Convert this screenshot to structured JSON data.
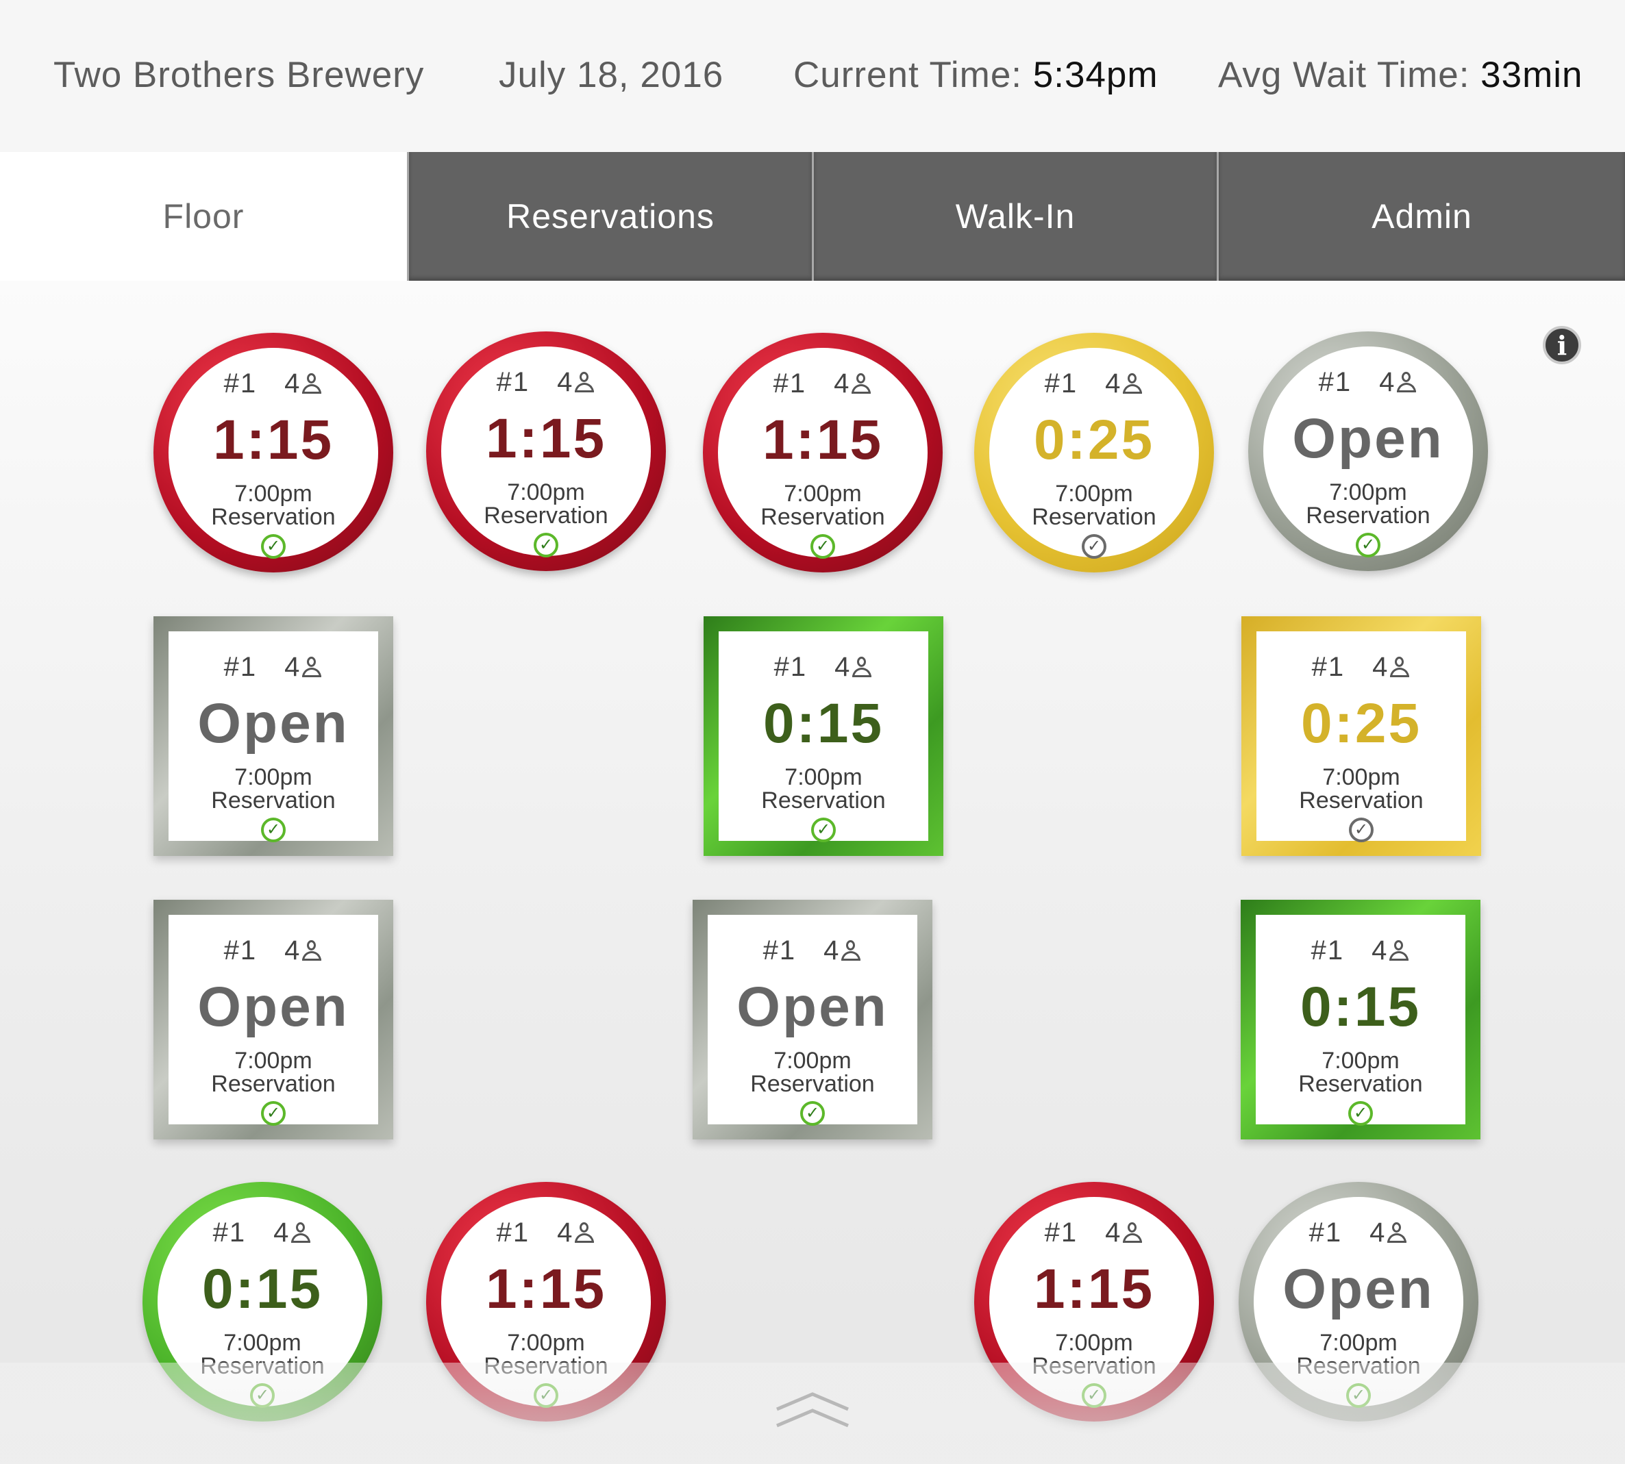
{
  "header": {
    "restaurant": "Two Brothers Brewery",
    "date": "July 18, 2016",
    "current_time_label": "Current Time:",
    "current_time_value": "5:34pm",
    "avg_wait_label": "Avg Wait Time:",
    "avg_wait_value": "33min"
  },
  "tabs": [
    {
      "label": "Floor",
      "active": true
    },
    {
      "label": "Reservations"
    },
    {
      "label": "Walk-In"
    },
    {
      "label": "Admin"
    }
  ],
  "tables": [
    {
      "number": "#1",
      "seats": "4",
      "big": "1:15",
      "time": "7:00pm",
      "label": "Reservation",
      "status": "red",
      "confirmed": true
    },
    {
      "number": "#1",
      "seats": "4",
      "big": "1:15",
      "time": "7:00pm",
      "label": "Reservation",
      "status": "red",
      "confirmed": true
    },
    {
      "number": "#1",
      "seats": "4",
      "big": "1:15",
      "time": "7:00pm",
      "label": "Reservation",
      "status": "red",
      "confirmed": true
    },
    {
      "number": "#1",
      "seats": "4",
      "big": "0:25",
      "time": "7:00pm",
      "label": "Reservation",
      "status": "yellow",
      "confirmed": false
    },
    {
      "number": "#1",
      "seats": "4",
      "big": "Open",
      "time": "7:00pm",
      "label": "Reservation",
      "status": "gray",
      "confirmed": true
    },
    {
      "number": "#1",
      "seats": "4",
      "big": "Open",
      "time": "7:00pm",
      "label": "Reservation",
      "status": "gray",
      "confirmed": true
    },
    {
      "number": "#1",
      "seats": "4",
      "big": "0:15",
      "time": "7:00pm",
      "label": "Reservation",
      "status": "green",
      "confirmed": true
    },
    {
      "number": "#1",
      "seats": "4",
      "big": "0:25",
      "time": "7:00pm",
      "label": "Reservation",
      "status": "yellow",
      "confirmed": false
    },
    {
      "number": "#1",
      "seats": "4",
      "big": "Open",
      "time": "7:00pm",
      "label": "Reservation",
      "status": "gray",
      "confirmed": true
    },
    {
      "number": "#1",
      "seats": "4",
      "big": "Open",
      "time": "7:00pm",
      "label": "Reservation",
      "status": "gray",
      "confirmed": true
    },
    {
      "number": "#1",
      "seats": "4",
      "big": "0:15",
      "time": "7:00pm",
      "label": "Reservation",
      "status": "green",
      "confirmed": true
    },
    {
      "number": "#1",
      "seats": "4",
      "big": "0:15",
      "time": "7:00pm",
      "label": "Reservation",
      "status": "green",
      "confirmed": true
    },
    {
      "number": "#1",
      "seats": "4",
      "big": "1:15",
      "time": "7:00pm",
      "label": "Reservation",
      "status": "red",
      "confirmed": true
    },
    {
      "number": "#1",
      "seats": "4",
      "big": "1:15",
      "time": "7:00pm",
      "label": "Reservation",
      "status": "red",
      "confirmed": true
    },
    {
      "number": "#1",
      "seats": "4",
      "big": "Open",
      "time": "7:00pm",
      "label": "Reservation",
      "status": "gray",
      "confirmed": true
    }
  ],
  "icons": {
    "info": "info-icon",
    "seats": "person-icon",
    "confirmed": "check-circle-icon",
    "drawer": "chevron-up-icon"
  },
  "colors": {
    "tab_bar": "#626262",
    "status_red": "#b30d22",
    "status_yellow": "#e6c232",
    "status_green": "#4cb42a",
    "status_gray": "#9aa095"
  }
}
